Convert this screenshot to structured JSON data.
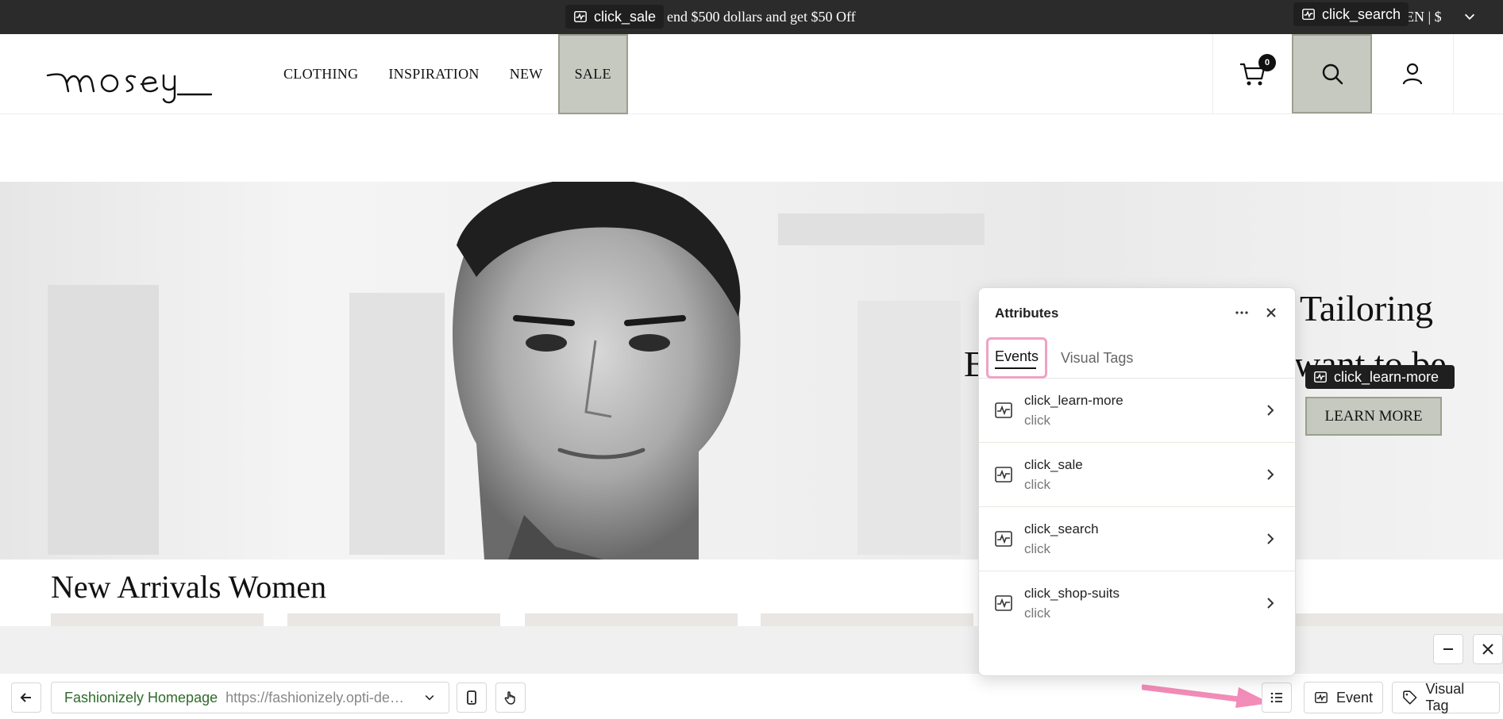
{
  "promo": {
    "text": "end $500 dollars and get $50 Off",
    "lang": "EN | $"
  },
  "tags": {
    "sale": "click_sale",
    "search": "click_search",
    "learn_more": "click_learn-more"
  },
  "header": {
    "logo_text": "mosey",
    "nav": [
      "CLOTHING",
      "INSPIRATION",
      "NEW",
      "SALE"
    ],
    "cart_count": "0"
  },
  "hero": {
    "line1": "Tailoring",
    "line2_left": "E",
    "line2_right": "want to be",
    "button": "LEARN MORE"
  },
  "section": {
    "title": "New Arrivals Women"
  },
  "panel": {
    "title": "Attributes",
    "tabs": [
      "Events",
      "Visual Tags"
    ],
    "events": [
      {
        "name": "click_learn-more",
        "type": "click"
      },
      {
        "name": "click_sale",
        "type": "click"
      },
      {
        "name": "click_search",
        "type": "click"
      },
      {
        "name": "click_shop-suits",
        "type": "click"
      }
    ]
  },
  "bottombar": {
    "page_name": "Fashionizely Homepage",
    "page_url": "https://fashionizely.opti-demo...",
    "event_label": "Event",
    "visual_tag_label": "Visual Tag"
  },
  "colors": {
    "highlight_fill": "#c5c9c0",
    "highlight_border": "#9aa08e",
    "accent_pink": "#f0a2c4",
    "page_name_green": "#2f6b2a"
  }
}
